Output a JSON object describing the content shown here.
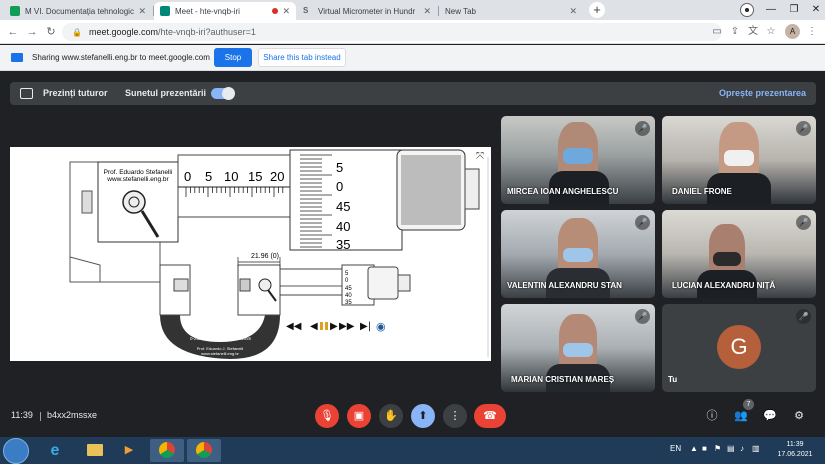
{
  "browser": {
    "tabs": [
      {
        "title": "M VI. Documentația tehnologică",
        "favicon_color": "#0f9d58"
      },
      {
        "title": "Meet - hte-vnqb-iri",
        "favicon_color": "#00897b",
        "active": true
      },
      {
        "title": "Virtual Micrometer in Hundr",
        "favicon_color": "#5f6368"
      },
      {
        "title": "New Tab",
        "favicon_color": "#dee1e6"
      }
    ],
    "url": "meet.google.com",
    "url_path": "/hte-vnqb-iri?authuser=1",
    "profile_initial": "A"
  },
  "sharing": {
    "text": "Sharing www.stefanelli.eng.br to meet.google.com",
    "stop_label": "Stop",
    "share_this_label": "Share this tab instead"
  },
  "presentation_bar": {
    "present_label": "Prezinți tuturor",
    "sound_label": "Sunetul prezentării",
    "sound_on": true,
    "stop_label": "Oprește prezentarea"
  },
  "micrometer": {
    "author_line1": "Prof. Eduardo Stefanelli",
    "author_line2": "www.stefanelli.eng.br",
    "sleeve_scale": [
      "0",
      "5",
      "10",
      "15",
      "20"
    ],
    "thimble_scale": [
      "5",
      "0",
      "45",
      "40",
      "35"
    ],
    "reading": "21.96 (0)",
    "small_thimble_scale": [
      "5",
      "0",
      "45",
      "40",
      "35"
    ],
    "frame_label_left": "0-25mm",
    "frame_label_right": "0.01mm",
    "frame_credit1": "Prof. Eduardo J. Stefanelli",
    "frame_credit2": "www.stefanelli.eng.br"
  },
  "participants": [
    {
      "name": "MIRCEA IOAN ANGHELESCU",
      "muted": true
    },
    {
      "name": "DANIEL FRONE",
      "muted": true
    },
    {
      "name": "VALENTIN ALEXANDRU STAN",
      "muted": true
    },
    {
      "name": "LUCIAN ALEXANDRU NIȚĂ",
      "muted": true
    },
    {
      "name": "MARIAN CRISTIAN MAREȘ",
      "muted": true
    },
    {
      "name": "Tu",
      "initial": "G",
      "muted": true
    }
  ],
  "meeting": {
    "time": "11:39",
    "code": "b4xx2mssxe",
    "people_count": "7"
  },
  "taskbar": {
    "language": "EN",
    "clock_time": "11:39",
    "clock_date": "17.06.2021"
  }
}
